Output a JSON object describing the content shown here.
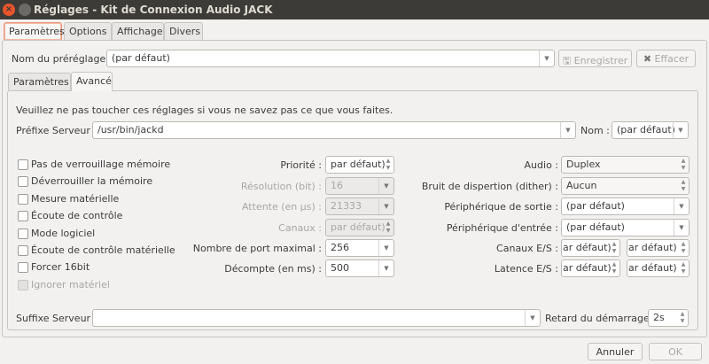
{
  "window": {
    "title": "Réglages - Kit de Connexion Audio JACK"
  },
  "outer_tabs": [
    "Paramètres",
    "Options",
    "Affichage",
    "Divers"
  ],
  "preset": {
    "label": "Nom du préréglage :",
    "value": "(par défaut)",
    "save": "Enregistrer",
    "clear": "Effacer"
  },
  "inner_tabs": [
    "Paramètres",
    "Avancé"
  ],
  "warning": "Veuillez ne pas toucher ces réglages si vous ne savez pas ce que vous faites.",
  "server_prefix": {
    "label": "Préfixe Serveur :",
    "value": "/usr/bin/jackd",
    "name_label": "Nom :",
    "name_value": "(par défaut)"
  },
  "checkboxes": [
    {
      "label": "Pas de verrouillage mémoire",
      "checked": false,
      "disabled": false
    },
    {
      "label": "Déverrouiller la mémoire",
      "checked": false,
      "disabled": false
    },
    {
      "label": "Mesure matérielle",
      "checked": false,
      "disabled": false
    },
    {
      "label": "Écoute de contrôle",
      "checked": false,
      "disabled": false
    },
    {
      "label": "Mode logiciel",
      "checked": false,
      "disabled": false
    },
    {
      "label": "Écoute de contrôle matérielle",
      "checked": false,
      "disabled": false
    },
    {
      "label": "Forcer 16bit",
      "checked": false,
      "disabled": false
    },
    {
      "label": "Ignorer matériel",
      "checked": false,
      "disabled": true
    }
  ],
  "middle": [
    {
      "label": "Priorité :",
      "value": "par défaut)"
    },
    {
      "label": "Résolution (bit) :",
      "value": "16"
    },
    {
      "label": "Attente (en µs) :",
      "value": "21333"
    },
    {
      "label": "Canaux :",
      "value": "par défaut)"
    },
    {
      "label": "Nombre de port maximal :",
      "value": "256"
    },
    {
      "label": "Décompte (en ms) :",
      "value": "500"
    }
  ],
  "right": [
    {
      "label": "Audio :",
      "value": "Duplex"
    },
    {
      "label": "Bruit de dispertion (dither) :",
      "value": "Aucun"
    },
    {
      "label": "Périphérique de sortie :",
      "value": "(par défaut)"
    },
    {
      "label": "Périphérique d'entrée :",
      "value": "(par défaut)"
    },
    {
      "label": "Canaux E/S :",
      "value": "ar défaut)",
      "value2": "ar défaut)"
    },
    {
      "label": "Latence E/S :",
      "value": "ar défaut)",
      "value2": "ar défaut)"
    }
  ],
  "suffix": {
    "label": "Suffixe Serveur :",
    "value": "",
    "delay_label": "Retard du démarrage :",
    "delay_value": "2s"
  },
  "buttons": {
    "cancel": "Annuler",
    "ok": "OK"
  },
  "colors": {
    "close": "#e9542b",
    "titlebar": "#3c3b37",
    "tab_accent": "#e9967a"
  }
}
